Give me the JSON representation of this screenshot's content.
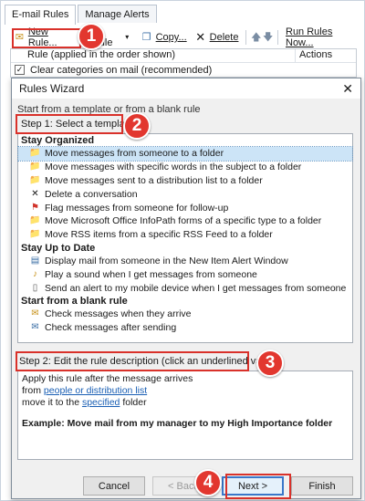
{
  "tabs": [
    {
      "label": "E-mail Rules",
      "active": true
    },
    {
      "label": "Manage Alerts",
      "active": false
    }
  ],
  "toolbar": {
    "new_rule": "New Rule...",
    "change_rule": "e Rule",
    "copy": "Copy...",
    "delete": "Delete",
    "run_rules": "Run Rules Now..."
  },
  "rules_list": {
    "col_rule": "Rule (applied in the order shown)",
    "col_actions": "Actions",
    "row_label": "Clear categories on mail (recommended)",
    "row_checked": true
  },
  "wizard": {
    "title": "Rules Wizard",
    "close_glyph": "✕",
    "start_text": "Start from a template or from a blank rule",
    "step1": "Step 1: Select a template",
    "step2": "Step 2: Edit the rule description (click an underlined value)",
    "groups": [
      {
        "title": "Stay Organized",
        "items": [
          {
            "label": "Move messages from someone to a folder",
            "icon": "folder-icon",
            "selected": true
          },
          {
            "label": "Move messages with specific words in the subject to a folder",
            "icon": "folder-icon",
            "selected": false
          },
          {
            "label": "Move messages sent to a distribution list to a folder",
            "icon": "folder-icon",
            "selected": false
          },
          {
            "label": "Delete a conversation",
            "icon": "delete-x-icon",
            "selected": false
          },
          {
            "label": "Flag messages from someone for follow-up",
            "icon": "flag-icon",
            "selected": false
          },
          {
            "label": "Move Microsoft Office InfoPath forms of a specific type to a folder",
            "icon": "folder-icon",
            "selected": false
          },
          {
            "label": "Move RSS items from a specific RSS Feed to a folder",
            "icon": "folder-icon",
            "selected": false
          }
        ]
      },
      {
        "title": "Stay Up to Date",
        "items": [
          {
            "label": "Display mail from someone in the New Item Alert Window",
            "icon": "alert-window-icon",
            "selected": false
          },
          {
            "label": "Play a sound when I get messages from someone",
            "icon": "sound-icon",
            "selected": false
          },
          {
            "label": "Send an alert to my mobile device when I get messages from someone",
            "icon": "mobile-icon",
            "selected": false
          }
        ]
      },
      {
        "title": "Start from a blank rule",
        "items": [
          {
            "label": "Check messages when they arrive",
            "icon": "envelope-icon",
            "selected": false
          },
          {
            "label": "Check messages after sending",
            "icon": "sent-mail-icon",
            "selected": false
          }
        ]
      }
    ],
    "description": {
      "line1": "Apply this rule after the message arrives",
      "line2_prefix": "from ",
      "line2_link": "people or distribution list",
      "line3_prefix": "move it to the ",
      "line3_link": "specified",
      "line3_suffix": " folder",
      "example": "Example: Move mail from my manager to my High Importance folder"
    },
    "buttons": {
      "cancel": "Cancel",
      "back": "< Back",
      "next": "Next >",
      "finish": "Finish"
    }
  },
  "callouts": [
    "1",
    "2",
    "3",
    "4"
  ],
  "colors": {
    "callout_red": "#e2372f",
    "selection_blue": "#cce4f7",
    "link_blue": "#1a5fb4"
  }
}
